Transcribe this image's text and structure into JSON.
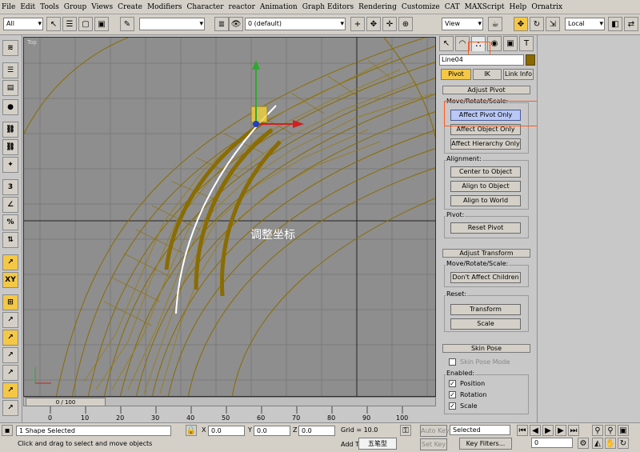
{
  "menu": [
    "File",
    "Edit",
    "Tools",
    "Group",
    "Views",
    "Create",
    "Modifiers",
    "Character",
    "reactor",
    "Animation",
    "Graph Editors",
    "Rendering",
    "Customize",
    "CAT",
    "MAXScript",
    "Help",
    "Ornatrix"
  ],
  "toolbar": {
    "selection_filter": "All",
    "layer": "0 (default)",
    "view": "View",
    "coord": "Local"
  },
  "viewport": {
    "label": "Top",
    "overlay_text": "调整坐标"
  },
  "timeline": {
    "frame": "0 / 100"
  },
  "ruler_ticks": [
    "0",
    "10",
    "20",
    "30",
    "40",
    "50",
    "60",
    "70",
    "80",
    "90",
    "100"
  ],
  "status": {
    "selection": "1 Shape Selected",
    "prompt": "Click and drag to select and move objects",
    "x_label": "X",
    "y_label": "Y",
    "z_label": "Z",
    "x_val": "0.0",
    "y_val": "0.0",
    "z_val": "0.0",
    "grid": "Grid = 10.0",
    "add": "Add T",
    "ime": "五笔型",
    "auto_key": "Auto Key",
    "set_key": "Set Key",
    "selected": "Selected",
    "key_filters": "Key Filters...",
    "frame_val": "0"
  },
  "cmd": {
    "object_name": "Line04",
    "subtabs": [
      "Pivot",
      "IK",
      "Link Info"
    ],
    "adjust_pivot": {
      "title": "Adjust Pivot",
      "move_group": "Move/Rotate/Scale:",
      "btn_affect_pivot": "Affect Pivot Only",
      "btn_affect_object": "Affect Object Only",
      "btn_affect_hierarchy": "Affect Hierarchy Only",
      "align_group": "Alignment:",
      "btn_center": "Center to Object",
      "btn_align_obj": "Align to Object",
      "btn_align_world": "Align to World",
      "pivot_group": "Pivot:",
      "btn_reset": "Reset Pivot"
    },
    "adjust_transform": {
      "title": "Adjust Transform",
      "move_group": "Move/Rotate/Scale:",
      "btn_dont_affect": "Don't Affect Children",
      "reset_group": "Reset:",
      "btn_transform": "Transform",
      "btn_scale": "Scale"
    },
    "skin_pose": {
      "title": "Skin Pose",
      "skin_pose_mode": "Skin Pose Mode",
      "enabled_group": "Enabled:",
      "position": "Position",
      "rotation": "Rotation",
      "scale": "Scale"
    }
  },
  "colors": {
    "wire": "#8a6c00",
    "highlight": "#ff5a1e",
    "pivot_active": "#b9c8f4"
  }
}
